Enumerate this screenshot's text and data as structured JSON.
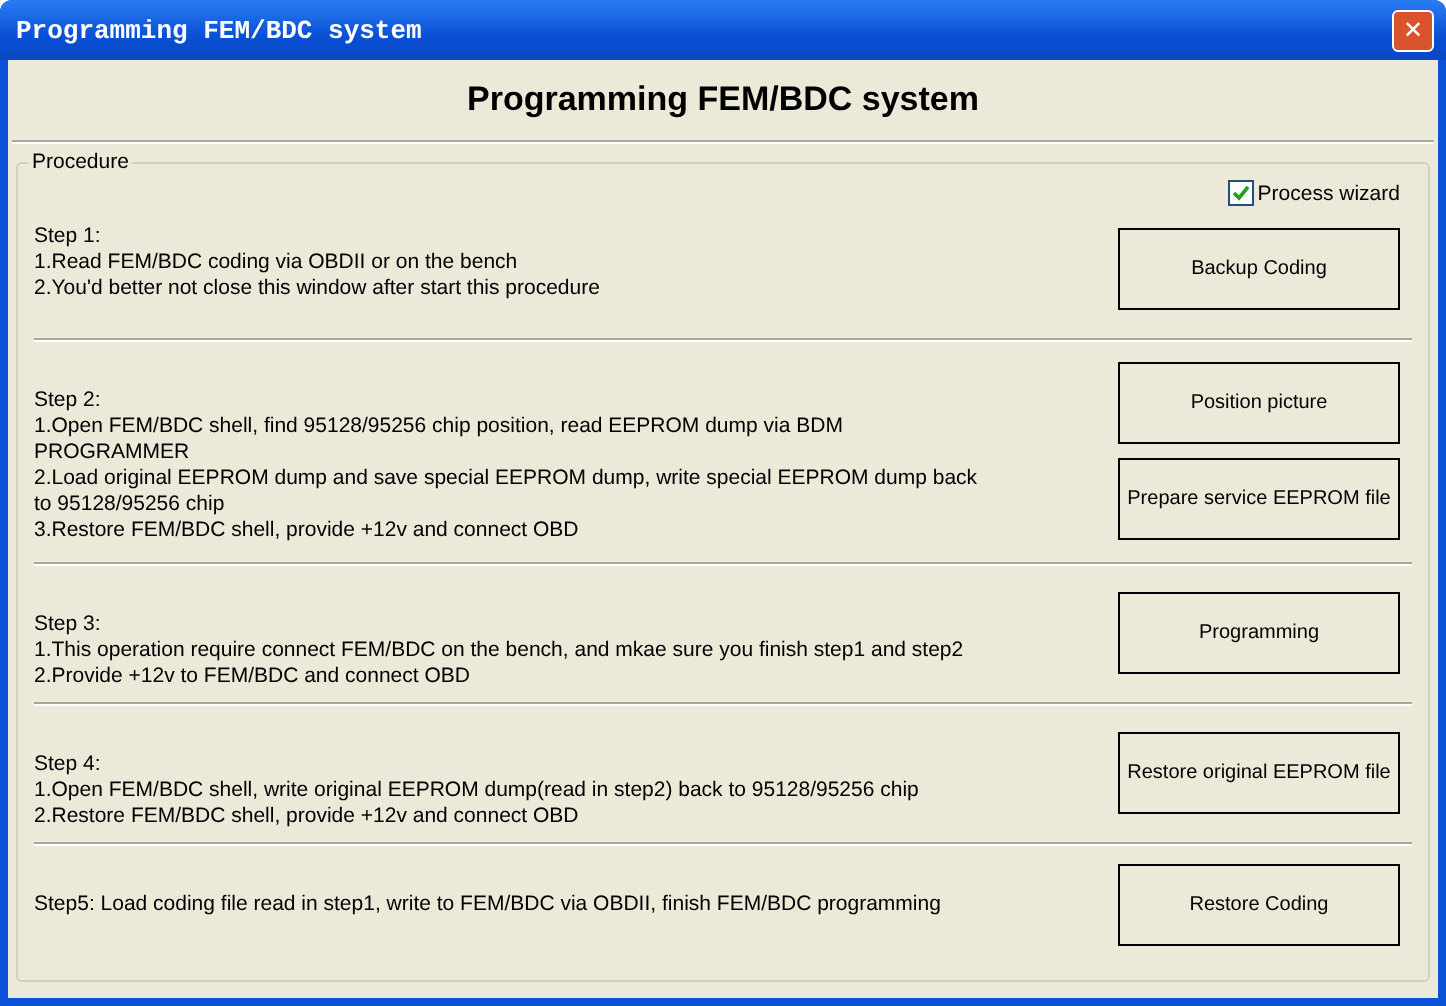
{
  "window": {
    "title": "Programming FEM/BDC system",
    "close": "✕"
  },
  "heading": "Programming FEM/BDC system",
  "group": {
    "label": "Procedure"
  },
  "wizard": {
    "label": "Process wizard",
    "checked": true
  },
  "steps": [
    {
      "title": "Step 1:",
      "lines": [
        "1.Read FEM/BDC coding via OBDII or on the bench",
        "2.You'd better not close this window after start this procedure"
      ],
      "buttons": [
        "Backup Coding"
      ]
    },
    {
      "title": "Step 2:",
      "lines": [
        "1.Open FEM/BDC shell, find 95128/95256 chip position, read EEPROM dump via BDM PROGRAMMER",
        "2.Load original EEPROM dump and save special EEPROM dump, write special EEPROM dump back to 95128/95256 chip",
        "3.Restore FEM/BDC shell, provide +12v and connect OBD"
      ],
      "buttons": [
        "Position picture",
        "Prepare service EEPROM file"
      ]
    },
    {
      "title": "Step 3:",
      "lines": [
        "1.This operation require connect FEM/BDC on the bench, and mkae sure you finish step1 and step2",
        "2.Provide +12v to FEM/BDC and connect OBD"
      ],
      "buttons": [
        "Programming"
      ]
    },
    {
      "title": "Step 4:",
      "lines": [
        "1.Open FEM/BDC shell, write original EEPROM dump(read in step2) back to 95128/95256 chip",
        "2.Restore FEM/BDC shell, provide +12v and connect OBD"
      ],
      "buttons": [
        "Restore original EEPROM file"
      ]
    },
    {
      "title": "Step5: Load coding file read in step1, write to FEM/BDC via OBDII, finish FEM/BDC programming",
      "buttons": [
        "Restore Coding"
      ]
    }
  ]
}
